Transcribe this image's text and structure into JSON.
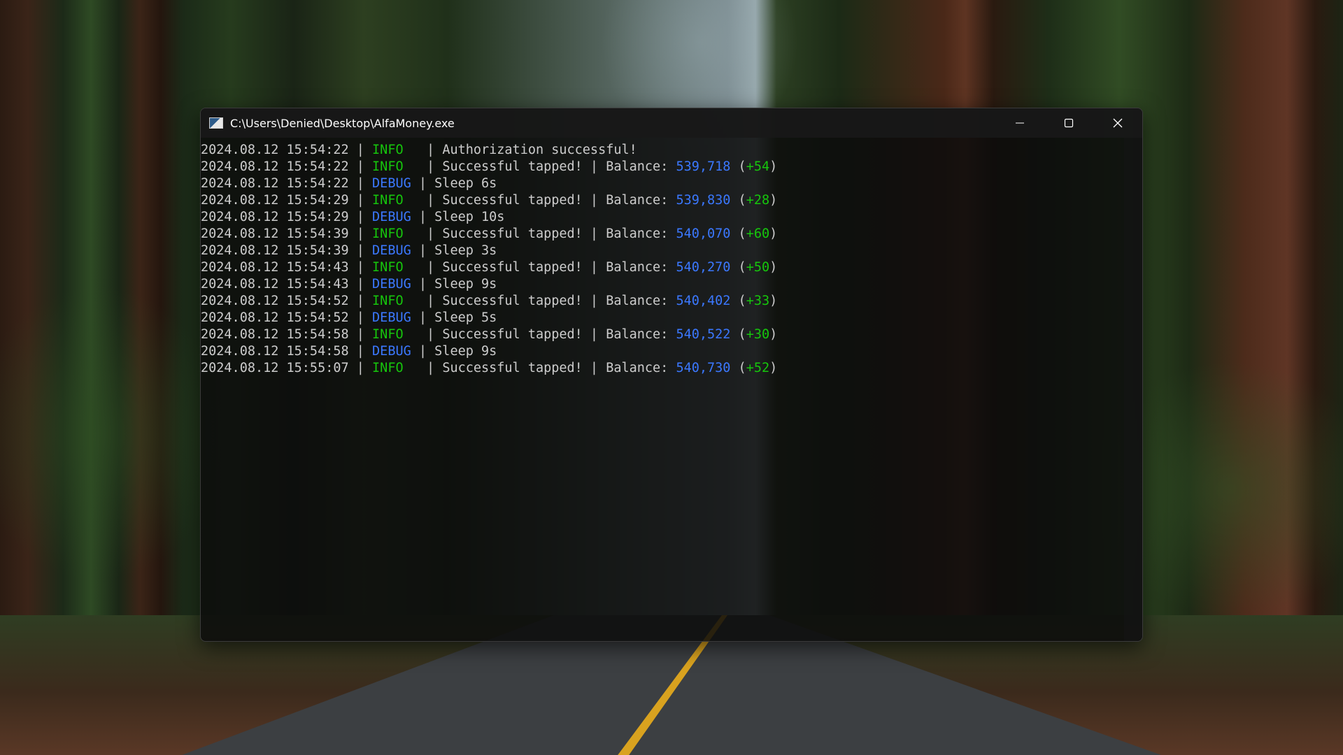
{
  "window": {
    "title": "C:\\Users\\Denied\\Desktop\\AlfaMoney.exe",
    "controls": {
      "minimize_icon": "minimize-icon",
      "maximize_icon": "maximize-icon",
      "close_icon": "close-icon"
    }
  },
  "colors": {
    "info": "#16c60c",
    "debug": "#3b78ff",
    "balance": "#3b78ff",
    "delta": "#16c60c",
    "text": "#cccccc",
    "console_bg": "#0c0c0c"
  },
  "console": {
    "lines": [
      {
        "timestamp": "2024.08.12 15:54:22",
        "sep1": " | ",
        "level": "INFO",
        "level_pad": "  ",
        "sep2": " | ",
        "message": "Authorization successful!"
      },
      {
        "timestamp": "2024.08.12 15:54:22",
        "sep1": " | ",
        "level": "INFO",
        "level_pad": "  ",
        "sep2": " | ",
        "message": "Successful tapped! | Balance: ",
        "balance": "539,718",
        "delta": "+54"
      },
      {
        "timestamp": "2024.08.12 15:54:22",
        "sep1": " | ",
        "level": "DEBUG",
        "level_pad": " ",
        "sep2": "| ",
        "message": "Sleep 6s"
      },
      {
        "timestamp": "2024.08.12 15:54:29",
        "sep1": " | ",
        "level": "INFO",
        "level_pad": "  ",
        "sep2": " | ",
        "message": "Successful tapped! | Balance: ",
        "balance": "539,830",
        "delta": "+28"
      },
      {
        "timestamp": "2024.08.12 15:54:29",
        "sep1": " | ",
        "level": "DEBUG",
        "level_pad": " ",
        "sep2": "| ",
        "message": "Sleep 10s"
      },
      {
        "timestamp": "2024.08.12 15:54:39",
        "sep1": " | ",
        "level": "INFO",
        "level_pad": "  ",
        "sep2": " | ",
        "message": "Successful tapped! | Balance: ",
        "balance": "540,070",
        "delta": "+60"
      },
      {
        "timestamp": "2024.08.12 15:54:39",
        "sep1": " | ",
        "level": "DEBUG",
        "level_pad": " ",
        "sep2": "| ",
        "message": "Sleep 3s"
      },
      {
        "timestamp": "2024.08.12 15:54:43",
        "sep1": " | ",
        "level": "INFO",
        "level_pad": "  ",
        "sep2": " | ",
        "message": "Successful tapped! | Balance: ",
        "balance": "540,270",
        "delta": "+50"
      },
      {
        "timestamp": "2024.08.12 15:54:43",
        "sep1": " | ",
        "level": "DEBUG",
        "level_pad": " ",
        "sep2": "| ",
        "message": "Sleep 9s"
      },
      {
        "timestamp": "2024.08.12 15:54:52",
        "sep1": " | ",
        "level": "INFO",
        "level_pad": "  ",
        "sep2": " | ",
        "message": "Successful tapped! | Balance: ",
        "balance": "540,402",
        "delta": "+33"
      },
      {
        "timestamp": "2024.08.12 15:54:52",
        "sep1": " | ",
        "level": "DEBUG",
        "level_pad": " ",
        "sep2": "| ",
        "message": "Sleep 5s"
      },
      {
        "timestamp": "2024.08.12 15:54:58",
        "sep1": " | ",
        "level": "INFO",
        "level_pad": "  ",
        "sep2": " | ",
        "message": "Successful tapped! | Balance: ",
        "balance": "540,522",
        "delta": "+30"
      },
      {
        "timestamp": "2024.08.12 15:54:58",
        "sep1": " | ",
        "level": "DEBUG",
        "level_pad": " ",
        "sep2": "| ",
        "message": "Sleep 9s"
      },
      {
        "timestamp": "2024.08.12 15:55:07",
        "sep1": " | ",
        "level": "INFO",
        "level_pad": "  ",
        "sep2": " | ",
        "message": "Successful tapped! | Balance: ",
        "balance": "540,730",
        "delta": "+52"
      }
    ]
  }
}
